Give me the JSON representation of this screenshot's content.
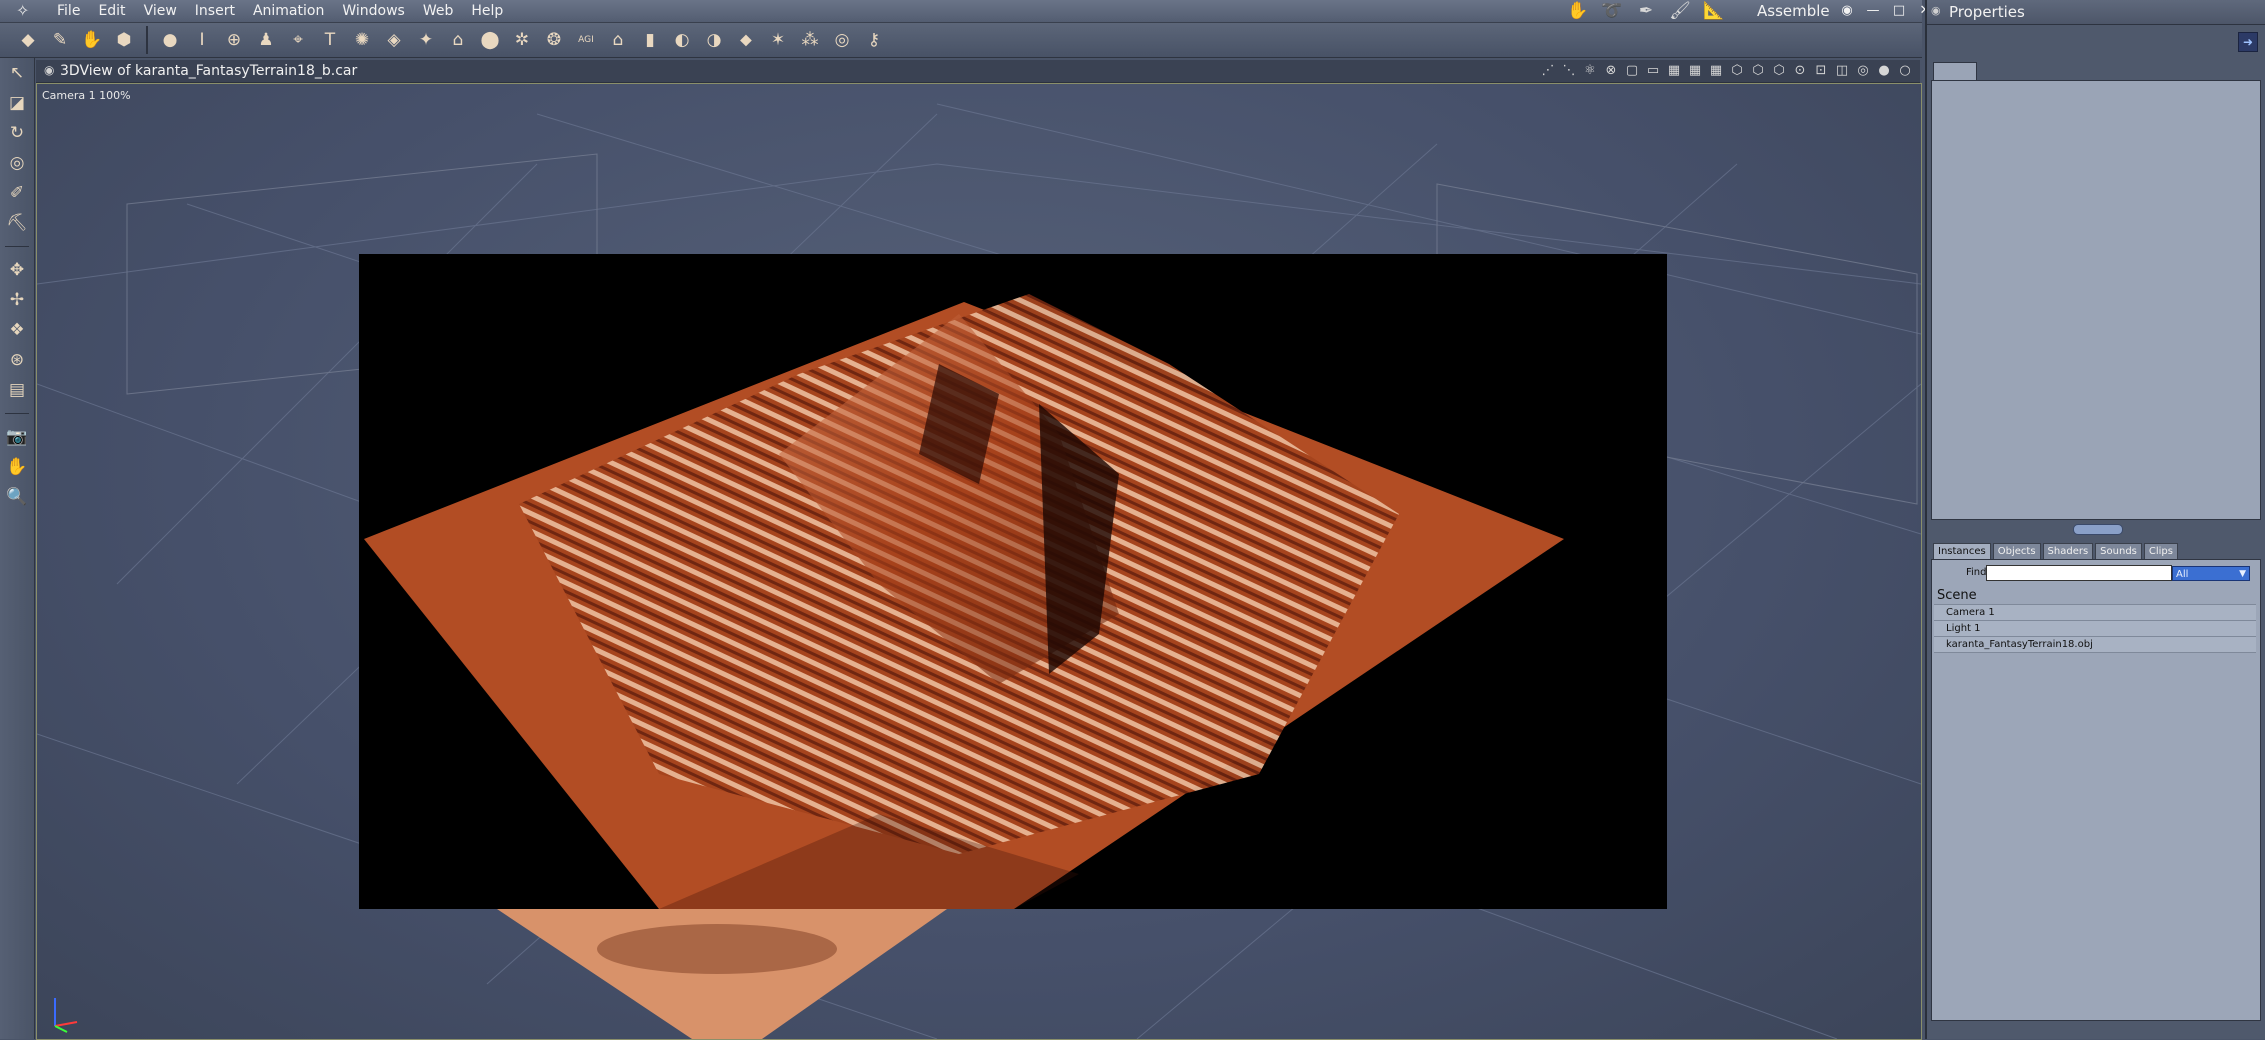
{
  "menubar": {
    "menus": [
      "File",
      "Edit",
      "View",
      "Insert",
      "Animation",
      "Windows",
      "Web",
      "Help"
    ],
    "rooms": [
      "hand-icon",
      "lasso-icon",
      "pen-icon",
      "brush-icon",
      "ruler-icon"
    ],
    "room_label": "Assemble",
    "window_controls": [
      "◉",
      "—",
      "□",
      "✕"
    ]
  },
  "toolbar": {
    "tools": [
      "◆",
      "✎",
      "✋",
      "⬢",
      "●",
      "Ⅰ",
      "⊕",
      "♟",
      "⌖",
      "T",
      "✺",
      "◈",
      "✦",
      "⌂",
      "⬤",
      "✲",
      "❂",
      "AGI",
      "⌂",
      "▮",
      "◐",
      "◑",
      "⬥",
      "✶",
      "⁂",
      "◎",
      "⚷"
    ]
  },
  "leftbar": {
    "group1": [
      "↖",
      "◪",
      "↻",
      "◎",
      "✐",
      "⛏"
    ],
    "group2": [
      "✥",
      "✢",
      "❖",
      "⊛",
      "▤"
    ],
    "group3": [
      "📷",
      "✋",
      "🔍"
    ]
  },
  "viewport": {
    "title": "3DView of karanta_FantasyTerrain18_b.car",
    "camera_label": "Camera 1 100%",
    "view_icons": [
      "⋰",
      "⋱",
      "⚛",
      "⊗",
      "▢",
      "▭",
      "▦",
      "▦",
      "▦",
      "⬡",
      "⬡",
      "⬡",
      "⊙",
      "⊡",
      "◫",
      "◎",
      "●",
      "○"
    ]
  },
  "right_panel": {
    "title": "Properties",
    "library_tabs": [
      "Instances",
      "Objects",
      "Shaders",
      "Sounds",
      "Clips"
    ],
    "active_tab": "Instances",
    "find_label": "Find:",
    "find_value": "",
    "filter_value": "All",
    "tree": {
      "root": "Scene",
      "items": [
        "Camera 1",
        "Light 1",
        "karanta_FantasyTerrain18.obj"
      ]
    }
  },
  "colors": {
    "viewport_bg": "#4a5468",
    "terrain": "#b4461a",
    "selection_blue": "#3b6fd2"
  }
}
